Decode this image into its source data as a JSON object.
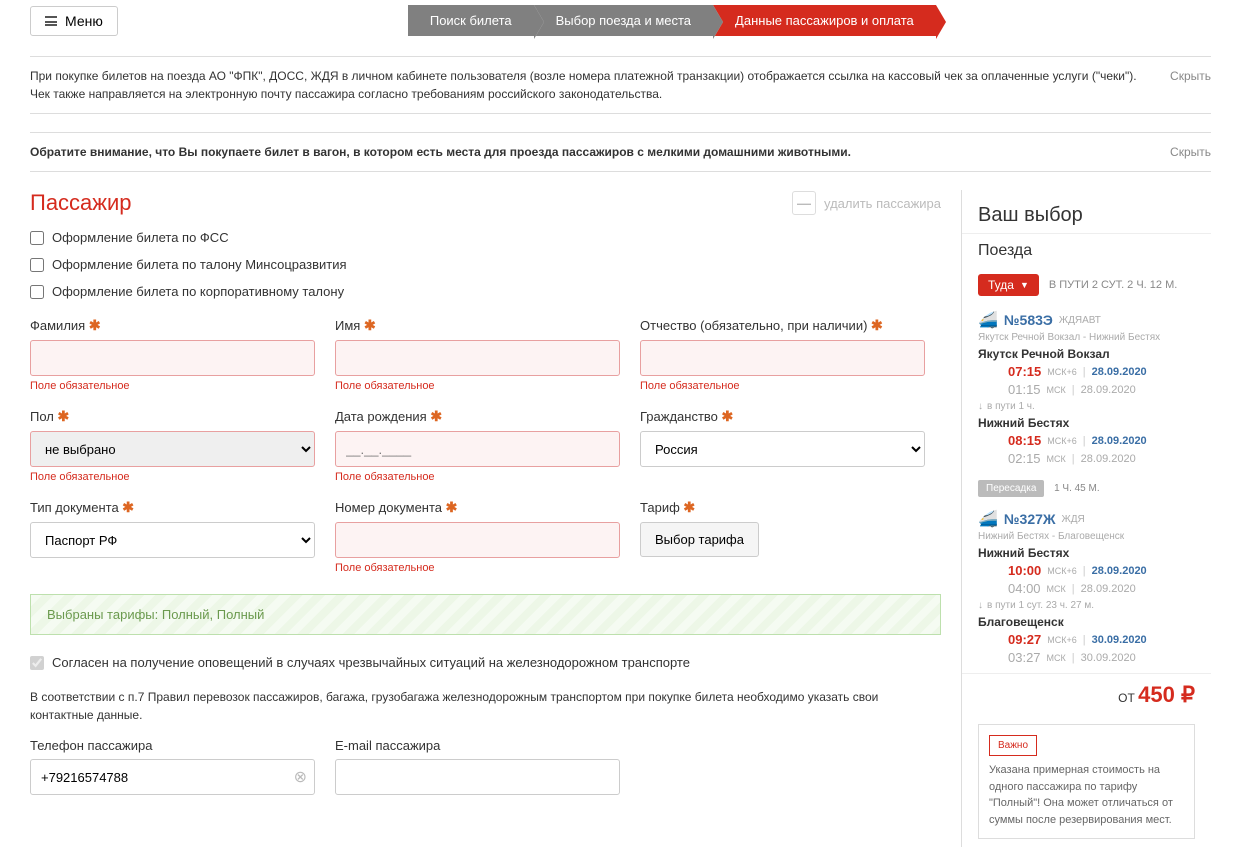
{
  "header": {
    "menu": "Меню"
  },
  "breadcrumb": {
    "c1": "Поиск билета",
    "c2": "Выбор поезда и места",
    "c3": "Данные пассажиров и оплата"
  },
  "notices": {
    "n1": "При покупке билетов на поезда АО \"ФПК\", ДОСС, ЖДЯ в личном кабинете пользователя (возле номера платежной транзакции) отображается ссылка на кассовый чек за оплаченные услуги (\"чеки\"). Чек также направляется на электронную почту пассажира согласно требованиям российского законодательства.",
    "n2": "Обратите внимание, что Вы покупаете билет в вагон, в котором есть места для проезда пассажиров с мелкими домашними животными.",
    "hide": "Скрыть"
  },
  "passenger": {
    "title": "Пассажир",
    "delete": "удалить пассажира",
    "minus": "—",
    "chk1": "Оформление билета по ФСС",
    "chk2": "Оформление билета по талону Минсоцразвития",
    "chk3": "Оформление билета по корпоративному талону"
  },
  "fields": {
    "lastname": {
      "label": "Фамилия",
      "err": "Поле обязательное"
    },
    "firstname": {
      "label": "Имя",
      "err": "Поле обязательное"
    },
    "middlename": {
      "label": "Отчество (обязательно, при наличии)",
      "err": "Поле обязательное"
    },
    "gender": {
      "label": "Пол",
      "value": "не выбрано",
      "err": "Поле обязательное"
    },
    "dob": {
      "label": "Дата рождения",
      "placeholder": "__.__.____",
      "err": "Поле обязательное"
    },
    "citizenship": {
      "label": "Гражданство",
      "value": "Россия"
    },
    "doctype": {
      "label": "Тип документа",
      "value": "Паспорт РФ"
    },
    "docnum": {
      "label": "Номер документа",
      "err": "Поле обязательное"
    },
    "tariff": {
      "label": "Тариф",
      "button": "Выбор тарифа"
    }
  },
  "tariff_selected": "Выбраны тарифы: Полный, Полный",
  "consent": "Согласен на получение оповещений в случаях чрезвычайных ситуаций на железнодорожном транспорте",
  "contact_info": "В соответствии с п.7 Правил перевозок пассажиров, багажа, грузобагажа железнодорожным транспортом при покупке билета необходимо указать свои контактные данные.",
  "contact": {
    "phone_label": "Телефон пассажира",
    "phone_value": "+79216574788",
    "email_label": "E-mail пассажира"
  },
  "sidebar": {
    "title": "Ваш выбор",
    "trains": "Поезда",
    "dir": "Туда",
    "travel_time": "В ПУТИ 2 СУТ. 2 Ч. 12 М.",
    "t1": {
      "num": "№583Э",
      "co": "ЖДЯАВТ",
      "route": "Якутск Речной Вокзал - Нижний Бестях",
      "from": "Якутск Речной Вокзал",
      "dep_t": "07:15",
      "dep_tz": "МСК+6",
      "dep_d": "28.09.2020",
      "dep_t2": "01:15",
      "dep_tz2": "МСК",
      "dep_d2": "28.09.2020",
      "wait": "в пути  1 ч.",
      "to": "Нижний Бестях",
      "arr_t": "08:15",
      "arr_tz": "МСК+6",
      "arr_d": "28.09.2020",
      "arr_t2": "02:15",
      "arr_tz2": "МСК",
      "arr_d2": "28.09.2020"
    },
    "transfer": {
      "label": "Пересадка",
      "time": "1 Ч. 45 М."
    },
    "t2": {
      "num": "№327Ж",
      "co": "ЖДЯ",
      "route": "Нижний Бестях - Благовещенск",
      "from": "Нижний Бестях",
      "dep_t": "10:00",
      "dep_tz": "МСК+6",
      "dep_d": "28.09.2020",
      "dep_t2": "04:00",
      "dep_tz2": "МСК",
      "dep_d2": "28.09.2020",
      "wait": "в пути  1 сут. 23 ч. 27 м.",
      "to": "Благовещенск",
      "arr_t": "09:27",
      "arr_tz": "МСК+6",
      "arr_d": "30.09.2020",
      "arr_t2": "03:27",
      "arr_tz2": "МСК",
      "arr_d2": "30.09.2020"
    },
    "price_from": "ОТ",
    "price": "450 ₽",
    "important": {
      "label": "Важно",
      "text": "Указана примерная стоимость на одного пассажира по тарифу \"Полный\"! Она может отличаться от суммы после резервирования мест."
    }
  }
}
